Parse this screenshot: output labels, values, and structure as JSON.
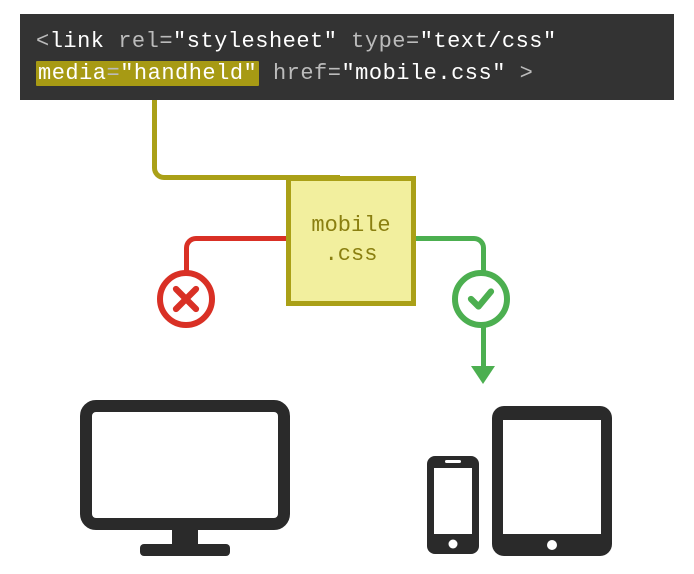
{
  "code": {
    "text_full": "<link rel=\"stylesheet\" type=\"text/css\" media=\"handheld\" href=\"mobile.css\" >",
    "open": "<",
    "tag": "link",
    "attr_rel": "rel",
    "val_rel": "\"stylesheet\"",
    "attr_type": "type",
    "val_type": "\"text/css\"",
    "attr_media": "media",
    "val_media": "\"handheld\"",
    "attr_href": "href",
    "val_href": "\"mobile.css\"",
    "close": ">",
    "eq": "="
  },
  "file": {
    "line1": "mobile",
    "line2": ".css"
  },
  "status": {
    "desktop": "rejected",
    "mobile": "accepted"
  },
  "colors": {
    "code_bg": "#333333",
    "highlight": "#a79a14",
    "olive": "#aaa017",
    "file_fill": "#f2ef9e",
    "red": "#d93025",
    "green": "#4caf50",
    "device": "#2a2a2a"
  }
}
